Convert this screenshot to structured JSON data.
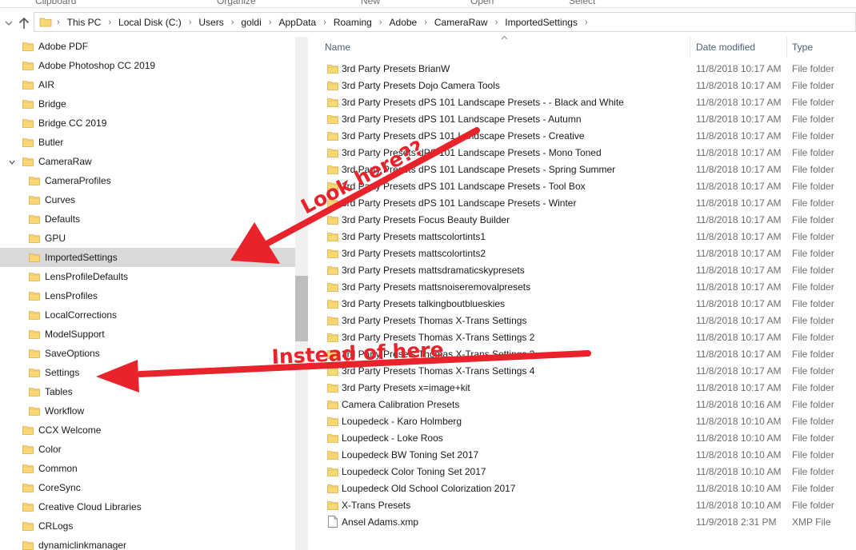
{
  "ribbon": {
    "groups": [
      "Clipboard",
      "Organize",
      "New",
      "Open",
      "Select"
    ]
  },
  "address": {
    "breadcrumbs": [
      "This PC",
      "Local Disk (C:)",
      "Users",
      "goldi",
      "AppData",
      "Roaming",
      "Adobe",
      "CameraRaw",
      "ImportedSettings"
    ]
  },
  "nav_tree": {
    "items": [
      {
        "label": "Adobe PDF",
        "level": 1
      },
      {
        "label": "Adobe Photoshop CC 2019",
        "level": 1
      },
      {
        "label": "AIR",
        "level": 1
      },
      {
        "label": "Bridge",
        "level": 1
      },
      {
        "label": "Bridge CC 2019",
        "level": 1
      },
      {
        "label": "Butler",
        "level": 1
      },
      {
        "label": "CameraRaw",
        "level": 1,
        "expanded": true
      },
      {
        "label": "CameraProfiles",
        "level": 2
      },
      {
        "label": "Curves",
        "level": 2
      },
      {
        "label": "Defaults",
        "level": 2
      },
      {
        "label": "GPU",
        "level": 2
      },
      {
        "label": "ImportedSettings",
        "level": 2,
        "selected": true
      },
      {
        "label": "LensProfileDefaults",
        "level": 2
      },
      {
        "label": "LensProfiles",
        "level": 2
      },
      {
        "label": "LocalCorrections",
        "level": 2
      },
      {
        "label": "ModelSupport",
        "level": 2
      },
      {
        "label": "SaveOptions",
        "level": 2
      },
      {
        "label": "Settings",
        "level": 2
      },
      {
        "label": "Tables",
        "level": 2
      },
      {
        "label": "Workflow",
        "level": 2
      },
      {
        "label": "CCX Welcome",
        "level": 1
      },
      {
        "label": "Color",
        "level": 1
      },
      {
        "label": "Common",
        "level": 1
      },
      {
        "label": "CoreSync",
        "level": 1
      },
      {
        "label": "Creative Cloud Libraries",
        "level": 1
      },
      {
        "label": "CRLogs",
        "level": 1
      },
      {
        "label": "dynamiclinkmanager",
        "level": 1
      }
    ]
  },
  "file_list": {
    "columns": {
      "name": "Name",
      "date": "Date modified",
      "type": "Type"
    },
    "rows": [
      {
        "name": "3rd Party Presets BrianW",
        "date": "11/8/2018 10:17 AM",
        "type": "File folder",
        "kind": "folder"
      },
      {
        "name": "3rd Party Presets Dojo Camera Tools",
        "date": "11/8/2018 10:17 AM",
        "type": "File folder",
        "kind": "folder"
      },
      {
        "name": "3rd Party Presets dPS 101 Landscape Presets - - Black and White",
        "date": "11/8/2018 10:17 AM",
        "type": "File folder",
        "kind": "folder"
      },
      {
        "name": "3rd Party Presets dPS 101 Landscape Presets - Autumn",
        "date": "11/8/2018 10:17 AM",
        "type": "File folder",
        "kind": "folder"
      },
      {
        "name": "3rd Party Presets dPS 101 Landscape Presets - Creative",
        "date": "11/8/2018 10:17 AM",
        "type": "File folder",
        "kind": "folder"
      },
      {
        "name": "3rd Party Presets dPS 101 Landscape Presets - Mono Toned",
        "date": "11/8/2018 10:17 AM",
        "type": "File folder",
        "kind": "folder"
      },
      {
        "name": "3rd Party Presets dPS 101 Landscape Presets - Spring Summer",
        "date": "11/8/2018 10:17 AM",
        "type": "File folder",
        "kind": "folder"
      },
      {
        "name": "3rd Party Presets dPS 101 Landscape Presets - Tool Box",
        "date": "11/8/2018 10:17 AM",
        "type": "File folder",
        "kind": "folder"
      },
      {
        "name": "3rd Party Presets dPS 101 Landscape Presets - Winter",
        "date": "11/8/2018 10:17 AM",
        "type": "File folder",
        "kind": "folder"
      },
      {
        "name": "3rd Party Presets Focus Beauty Builder",
        "date": "11/8/2018 10:17 AM",
        "type": "File folder",
        "kind": "folder"
      },
      {
        "name": "3rd Party Presets mattscolortints1",
        "date": "11/8/2018 10:17 AM",
        "type": "File folder",
        "kind": "folder"
      },
      {
        "name": "3rd Party Presets mattscolortints2",
        "date": "11/8/2018 10:17 AM",
        "type": "File folder",
        "kind": "folder"
      },
      {
        "name": "3rd Party Presets mattsdramaticskypresets",
        "date": "11/8/2018 10:17 AM",
        "type": "File folder",
        "kind": "folder"
      },
      {
        "name": "3rd Party Presets mattsnoiseremovalpresets",
        "date": "11/8/2018 10:17 AM",
        "type": "File folder",
        "kind": "folder"
      },
      {
        "name": "3rd Party Presets talkingboutblueskies",
        "date": "11/8/2018 10:17 AM",
        "type": "File folder",
        "kind": "folder"
      },
      {
        "name": "3rd Party Presets Thomas X-Trans Settings",
        "date": "11/8/2018 10:17 AM",
        "type": "File folder",
        "kind": "folder"
      },
      {
        "name": "3rd Party Presets Thomas X-Trans Settings 2",
        "date": "11/8/2018 10:17 AM",
        "type": "File folder",
        "kind": "folder"
      },
      {
        "name": "3rd Party Presets Thomas X-Trans Settings 3",
        "date": "11/8/2018 10:17 AM",
        "type": "File folder",
        "kind": "folder"
      },
      {
        "name": "3rd Party Presets Thomas X-Trans Settings 4",
        "date": "11/8/2018 10:17 AM",
        "type": "File folder",
        "kind": "folder"
      },
      {
        "name": "3rd Party Presets x=image+kit",
        "date": "11/8/2018 10:17 AM",
        "type": "File folder",
        "kind": "folder"
      },
      {
        "name": "Camera Calibration Presets",
        "date": "11/8/2018 10:16 AM",
        "type": "File folder",
        "kind": "folder"
      },
      {
        "name": "Loupedeck - Karo Holmberg",
        "date": "11/8/2018 10:10 AM",
        "type": "File folder",
        "kind": "folder"
      },
      {
        "name": "Loupedeck - Loke Roos",
        "date": "11/8/2018 10:10 AM",
        "type": "File folder",
        "kind": "folder"
      },
      {
        "name": "Loupedeck BW Toning Set 2017",
        "date": "11/8/2018 10:10 AM",
        "type": "File folder",
        "kind": "folder"
      },
      {
        "name": "Loupedeck Color Toning Set 2017",
        "date": "11/8/2018 10:10 AM",
        "type": "File folder",
        "kind": "folder"
      },
      {
        "name": "Loupedeck Old School Colorization 2017",
        "date": "11/8/2018 10:10 AM",
        "type": "File folder",
        "kind": "folder"
      },
      {
        "name": "X-Trans Presets",
        "date": "11/8/2018 10:10 AM",
        "type": "File folder",
        "kind": "folder"
      },
      {
        "name": "Ansel Adams.xmp",
        "date": "11/9/2018 2:31 PM",
        "type": "XMP File",
        "kind": "file"
      }
    ]
  },
  "annotations": {
    "look_here": "Look here??",
    "instead_of_here": "Instead of here",
    "color": "#e8232b"
  },
  "colors": {
    "folder_yellow": "#f8d775",
    "folder_dark": "#e0b34a",
    "selected_bg": "#d9d9d9",
    "header_text": "#4c607a"
  }
}
